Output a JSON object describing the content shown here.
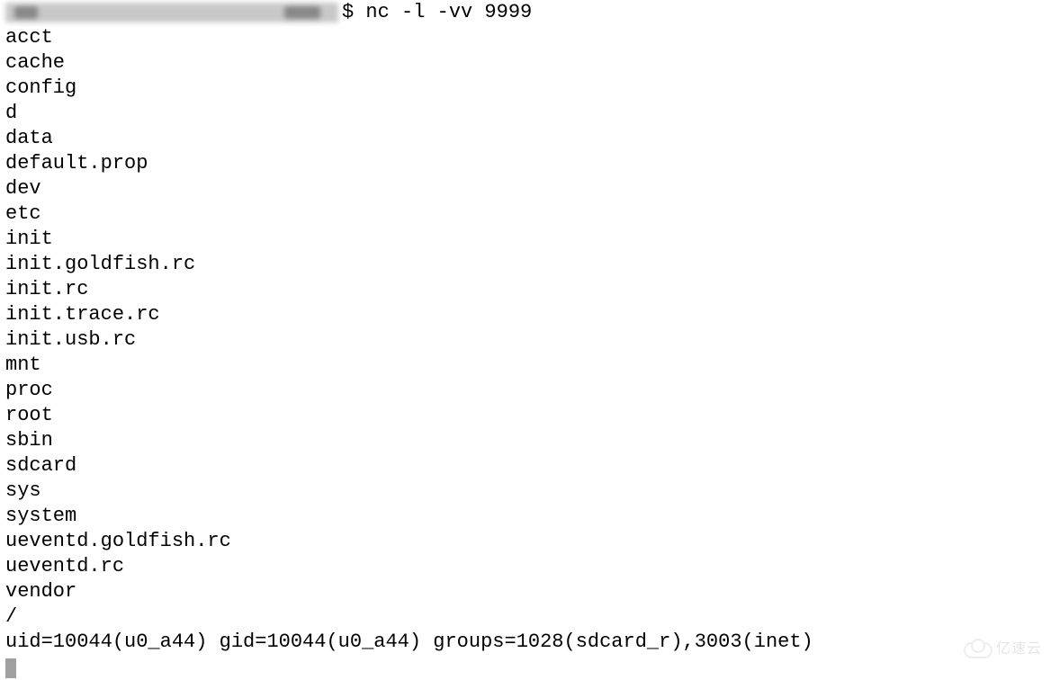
{
  "prompt": {
    "symbol": "$ ",
    "command": "nc -l -vv 9999"
  },
  "output": {
    "lines": [
      "acct",
      "cache",
      "config",
      "d",
      "data",
      "default.prop",
      "dev",
      "etc",
      "init",
      "init.goldfish.rc",
      "init.rc",
      "init.trace.rc",
      "init.usb.rc",
      "mnt",
      "proc",
      "root",
      "sbin",
      "sdcard",
      "sys",
      "system",
      "ueventd.goldfish.rc",
      "ueventd.rc",
      "vendor",
      "/",
      "uid=10044(u0_a44) gid=10044(u0_a44) groups=1028(sdcard_r),3003(inet)"
    ]
  },
  "watermark": {
    "text": "亿速云"
  }
}
